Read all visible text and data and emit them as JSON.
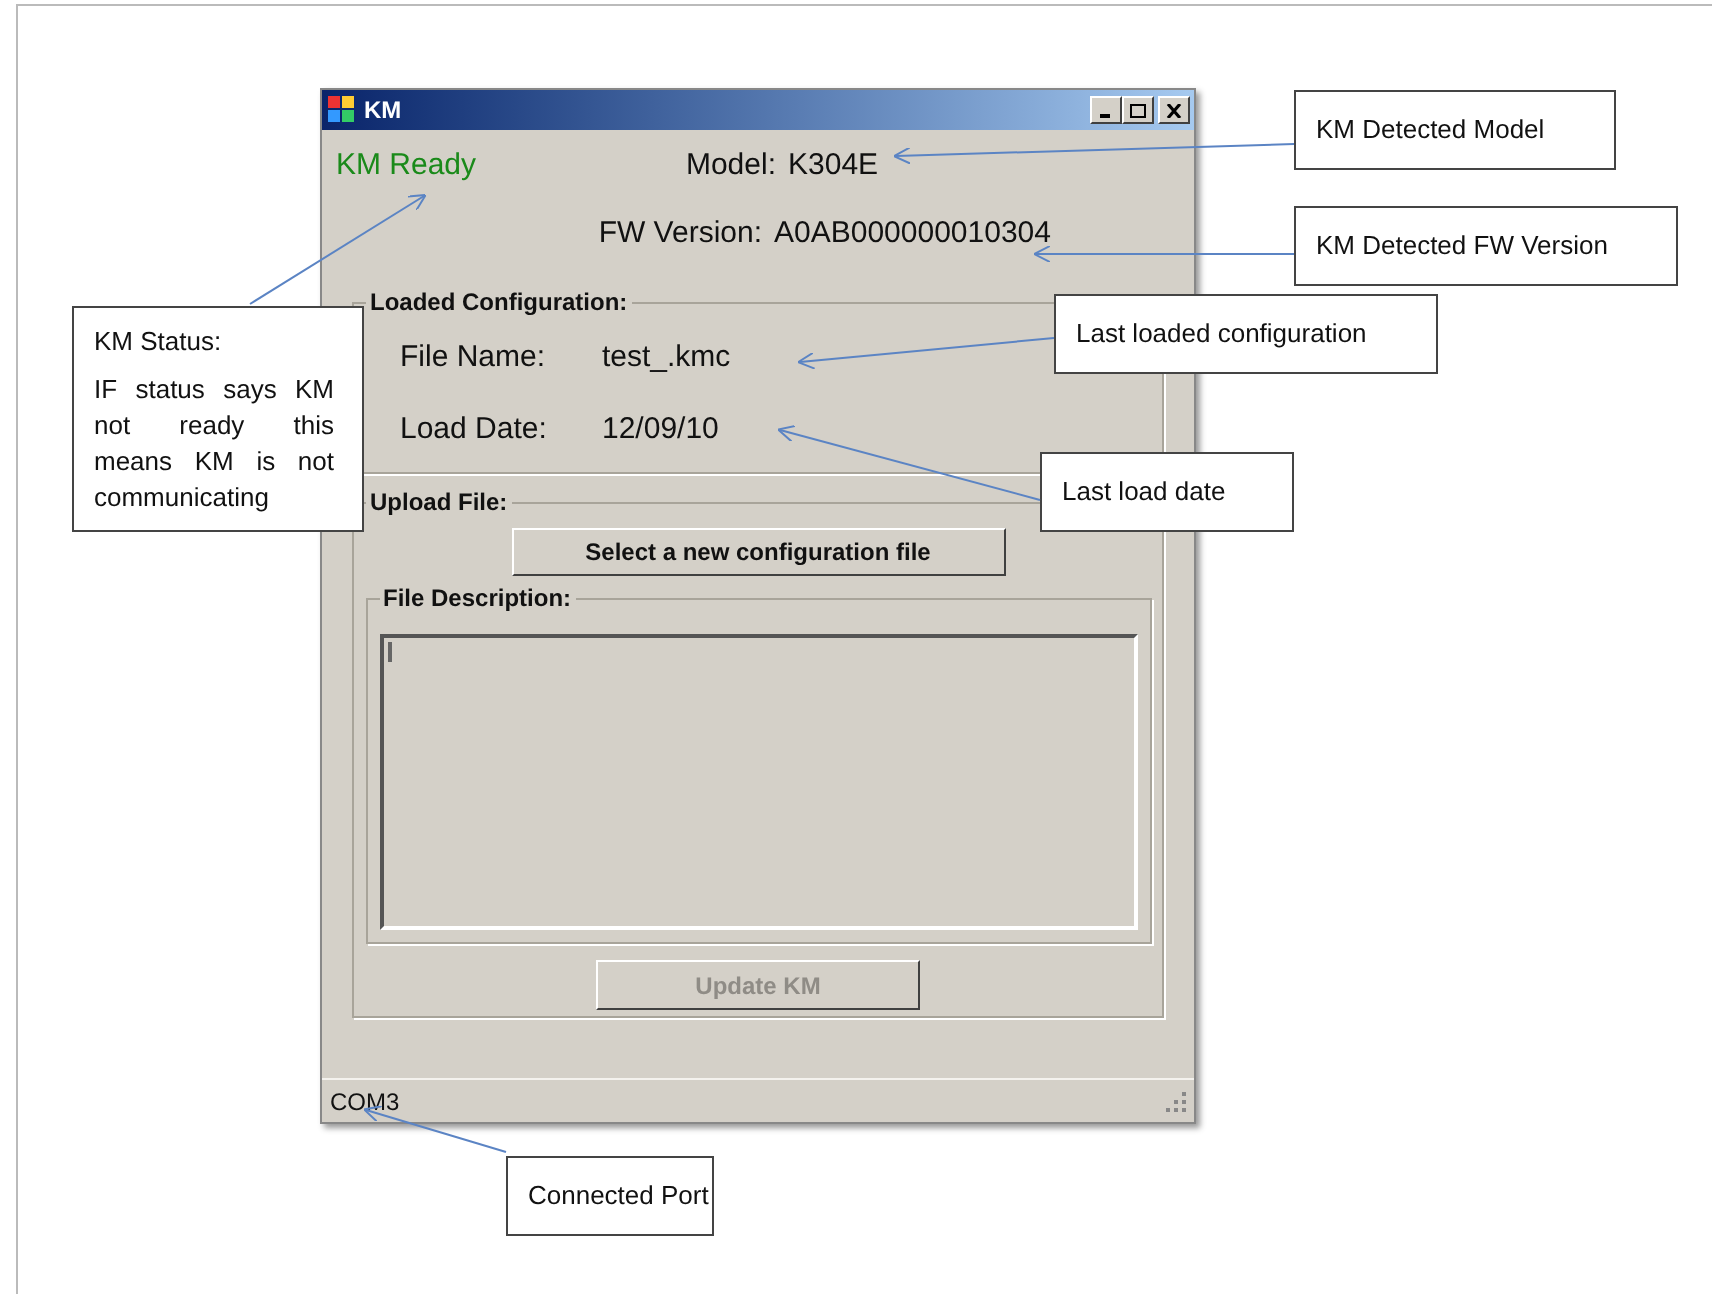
{
  "window": {
    "title": "KM",
    "ready": true,
    "status": "KM Ready",
    "model_label": "Model:",
    "model": "K304E",
    "fw_label": "FW Version:",
    "fw": "A0AB000000010304",
    "loaded_configuration": {
      "title": "Loaded Configuration:",
      "file_name_label": "File Name:",
      "file_name": "test_.kmc",
      "load_date_label": "Load Date:",
      "load_date": "12/09/10"
    },
    "upload_file": {
      "title": "Upload File:",
      "select_button": "Select a new configuration file",
      "file_description_title": "File Description:",
      "update_button": {
        "label": "Update KM",
        "disabled": true
      }
    },
    "status_bar": "COM3"
  },
  "callouts": [
    {
      "kind": "label",
      "text": "KM Detected Model"
    },
    {
      "kind": "label",
      "text": "KM Detected FW Version"
    },
    {
      "kind": "label",
      "text": "Last loaded configuration"
    },
    {
      "kind": "label",
      "text": "Last load date"
    },
    {
      "kind": "note",
      "title": "KM Status:",
      "text": "IF status says KM not ready this means KM is not communicating"
    },
    {
      "kind": "label",
      "text": "Connected Port"
    }
  ]
}
